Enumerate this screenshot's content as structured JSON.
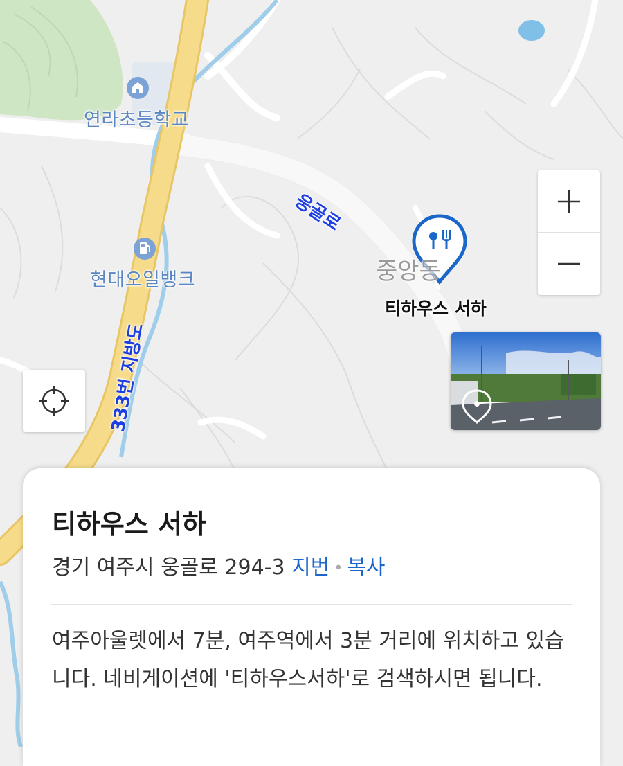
{
  "map": {
    "labels": {
      "school": "연라초등학교",
      "gas_station": "현대오일뱅크",
      "road_main": "웅골로",
      "road_highway": "333번 지방도",
      "area_faint": "중앙동"
    },
    "icons": {
      "school": "school-icon",
      "gas_station": "gas-station-icon",
      "restaurant_pin": "restaurant-pin-icon",
      "streetview_pin": "streetview-pin-icon"
    },
    "colors": {
      "pin": "#1b66c9",
      "road_label": "#1d3fe0",
      "poi_label": "#5a86c2",
      "highway": "#f2d680",
      "green": "#cfe6c4",
      "river": "#7fbfe8"
    }
  },
  "place": {
    "name": "티하우스 서하",
    "address": "경기 여주시 웅골로 294-3",
    "lot_link": "지번",
    "copy_link": "복사",
    "separator": "•",
    "description": "여주아울렛에서 7분, 여주역에서 3분 거리에 위치하고 있습니다. 네비게이션에 '티하우스서하'로 검색하시면 됩니다."
  },
  "controls": {
    "zoom_in": "+",
    "zoom_out": "−"
  }
}
